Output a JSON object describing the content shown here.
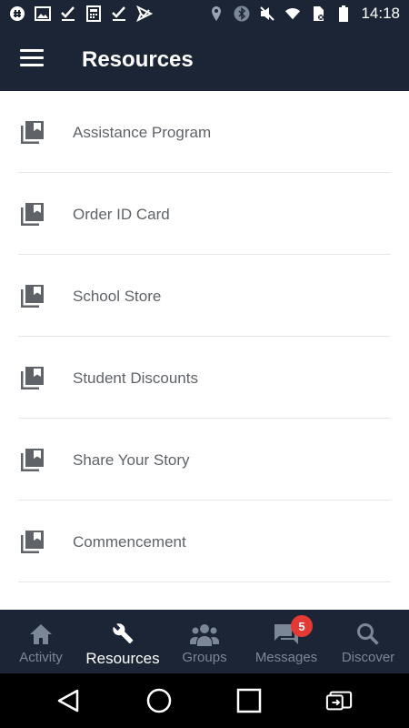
{
  "status_bar": {
    "time": "14:18",
    "left_icons": [
      "app-notification-icon",
      "image-icon",
      "check-icon",
      "calculator-icon",
      "check-icon",
      "send-check-icon"
    ],
    "right_icons": [
      "location-icon",
      "bluetooth-icon",
      "mute-icon",
      "wifi-icon",
      "sim-card-icon",
      "battery-icon"
    ]
  },
  "app_bar": {
    "title": "Resources",
    "menu_icon": "hamburger-menu-icon"
  },
  "resources": [
    {
      "label": "Assistance Program",
      "icon": "library-books-icon"
    },
    {
      "label": "Order ID Card",
      "icon": "library-books-icon"
    },
    {
      "label": "School Store",
      "icon": "library-books-icon"
    },
    {
      "label": "Student Discounts",
      "icon": "library-books-icon"
    },
    {
      "label": "Share Your Story",
      "icon": "library-books-icon"
    },
    {
      "label": "Commencement",
      "icon": "library-books-icon"
    }
  ],
  "bottom_nav": {
    "tabs": [
      {
        "label": "Activity",
        "icon": "home-icon",
        "active": false
      },
      {
        "label": "Resources",
        "icon": "wrench-icon",
        "active": true
      },
      {
        "label": "Groups",
        "icon": "groups-icon",
        "active": false
      },
      {
        "label": "Messages",
        "icon": "messages-icon",
        "active": false,
        "badge": "5"
      },
      {
        "label": "Discover",
        "icon": "search-icon",
        "active": false
      }
    ]
  },
  "android_nav": [
    "back-icon",
    "home-circle-icon",
    "recents-icon",
    "screen-rotate-icon"
  ],
  "colors": {
    "header_bg": "#1c2536",
    "nav_inactive": "#7b8696",
    "nav_active": "#ffffff",
    "item_text": "#5f6368",
    "badge": "#e53935"
  }
}
